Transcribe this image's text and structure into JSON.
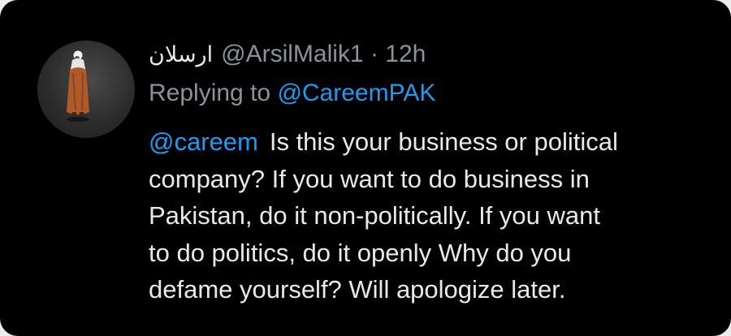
{
  "tweet": {
    "author": {
      "display_name": "ارسلان",
      "handle": "@ArsilMalik1",
      "separator": "·",
      "time": "12h",
      "avatar_icon": "person-in-robe-avatar"
    },
    "reply": {
      "prefix": "Replying to",
      "to_handle": "@CareemPAK"
    },
    "body": {
      "mention": "@careem",
      "lines": [
        "Is this your business or political",
        "company? If you want to do business in",
        "Pakistan, do it non-politically. If you want",
        "to do politics, do it openly Why do you",
        "defame yourself? Will apologize later."
      ]
    }
  },
  "colors": {
    "background": "#000000",
    "text": "#e7e9ea",
    "muted": "#8b9299",
    "link": "#1d9bf0"
  }
}
